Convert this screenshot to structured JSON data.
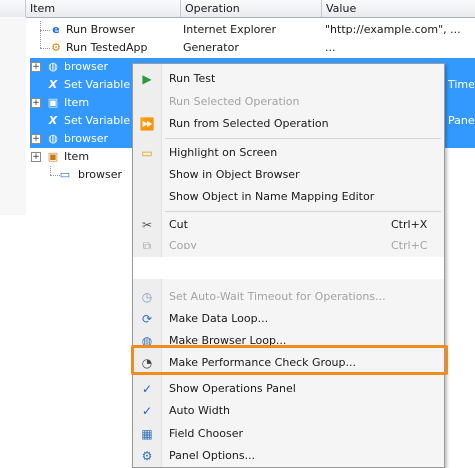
{
  "grid": {
    "columns": [
      "Item",
      "Operation",
      "Value"
    ],
    "rows": [
      {
        "item": "Run Browser",
        "icon": "ie-browser-icon",
        "operation": "Internet Explorer",
        "value": "\"http://example.com\", ...",
        "selected": false
      },
      {
        "item": "Run TestedApp",
        "icon": "app-icon",
        "operation": "Generator",
        "value": "...",
        "selected": false
      },
      {
        "item": "browser",
        "icon": "globe-icon",
        "operation": "",
        "value": "",
        "selected": true
      },
      {
        "item": "Set Variable Va",
        "icon": "variable-icon",
        "operation": "",
        "value": "Timeo",
        "selected": true
      },
      {
        "item": "Item",
        "icon": "item-icon",
        "operation": "",
        "value": "",
        "selected": true
      },
      {
        "item": "Set Variable Va",
        "icon": "variable-icon",
        "operation": "",
        "value": "PaneA",
        "selected": true
      },
      {
        "item": "browser",
        "icon": "globe-icon",
        "operation": "",
        "value": "",
        "selected": true
      },
      {
        "item": "Item",
        "icon": "item-icon",
        "operation": "",
        "value": "",
        "selected": false
      },
      {
        "item": "browser",
        "icon": "browser-window-icon",
        "operation": "",
        "value": "",
        "selected": false
      }
    ]
  },
  "menu": {
    "items": [
      {
        "label": "Run Test",
        "icon": "run-icon",
        "shortcut": "",
        "disabled": false
      },
      {
        "label": "Run Selected Operation",
        "icon": "",
        "shortcut": "",
        "disabled": true
      },
      {
        "label": "Run from Selected Operation",
        "icon": "run-from-icon",
        "shortcut": "",
        "disabled": false
      },
      {
        "label": "Highlight on Screen",
        "icon": "highlight-icon",
        "shortcut": "",
        "disabled": false
      },
      {
        "label": "Show in Object Browser",
        "icon": "",
        "shortcut": "",
        "disabled": false
      },
      {
        "label": "Show Object in Name Mapping Editor",
        "icon": "",
        "shortcut": "",
        "disabled": false
      },
      {
        "label": "Cut",
        "icon": "scissors-icon",
        "shortcut": "Ctrl+X",
        "disabled": false
      },
      {
        "label": "Copy",
        "icon": "copy-icon",
        "shortcut": "Ctrl+C",
        "disabled": true
      },
      {
        "label": "Set Auto-Wait Timeout for Operations...",
        "icon": "timeout-icon",
        "shortcut": "",
        "disabled": true
      },
      {
        "label": "Make Data Loop...",
        "icon": "data-loop-icon",
        "shortcut": "",
        "disabled": false
      },
      {
        "label": "Make Browser Loop...",
        "icon": "browser-loop-icon",
        "shortcut": "",
        "disabled": false
      },
      {
        "label": "Make Performance Check Group...",
        "icon": "performance-check-icon",
        "shortcut": "",
        "disabled": false
      },
      {
        "label": "Show Operations Panel",
        "icon": "checkmark-icon",
        "shortcut": "",
        "disabled": false
      },
      {
        "label": "Auto Width",
        "icon": "checkmark-icon",
        "shortcut": "",
        "disabled": false
      },
      {
        "label": "Field Chooser",
        "icon": "field-chooser-icon",
        "shortcut": "",
        "disabled": false
      },
      {
        "label": "Panel Options...",
        "icon": "panel-options-icon",
        "shortcut": "",
        "disabled": false
      }
    ]
  },
  "colors": {
    "selection": "#3399ff",
    "highlight_border": "#f08c1e",
    "menu_bg": "#f5f5f5"
  }
}
